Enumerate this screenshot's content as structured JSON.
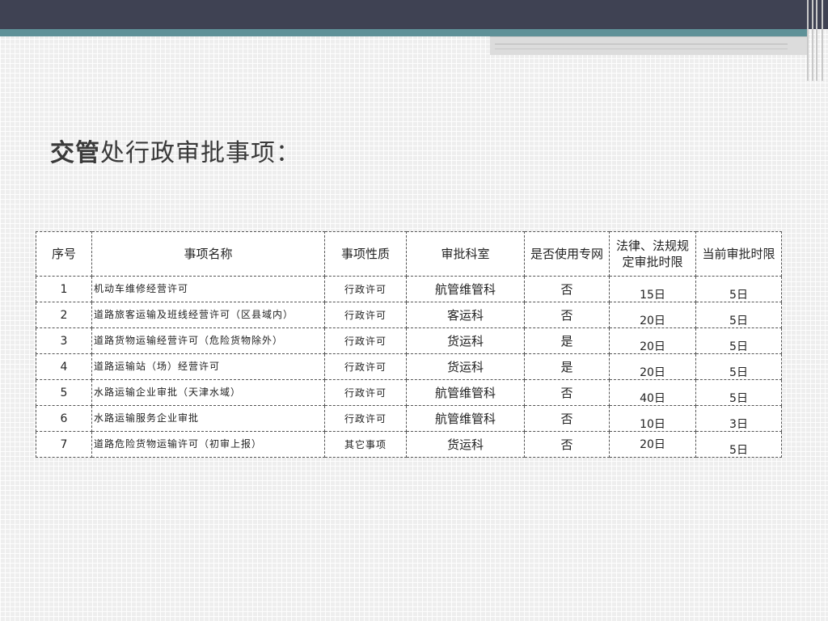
{
  "title": {
    "bold_part": "交管",
    "rest": "处行政审批事项："
  },
  "table": {
    "headers": {
      "index": "序号",
      "name": "事项名称",
      "nature": "事项性质",
      "dept": "审批科室",
      "network": "是否使用专网",
      "legal_limit": "法律、法规规定审批时限",
      "current_limit": "当前审批时限"
    },
    "rows": [
      {
        "index": "1",
        "name": "机动车维修经营许可",
        "nature": "行政许可",
        "dept": "航管维管科",
        "network": "否",
        "legal_limit": "15日",
        "current_limit": "5日"
      },
      {
        "index": "2",
        "name": "道路旅客运输及班线经营许可（区县域内）",
        "nature": "行政许可",
        "dept": "客运科",
        "network": "否",
        "legal_limit": "20日",
        "current_limit": "5日"
      },
      {
        "index": "3",
        "name": "道路货物运输经营许可（危险货物除外）",
        "nature": "行政许可",
        "dept": "货运科",
        "network": "是",
        "legal_limit": "20日",
        "current_limit": "5日"
      },
      {
        "index": "4",
        "name": "道路运输站（场）经营许可",
        "nature": "行政许可",
        "dept": "货运科",
        "network": "是",
        "legal_limit": "20日",
        "current_limit": "5日"
      },
      {
        "index": "5",
        "name": "水路运输企业审批（天津水域）",
        "nature": "行政许可",
        "dept": "航管维管科",
        "network": "否",
        "legal_limit": "40日",
        "current_limit": "5日"
      },
      {
        "index": "6",
        "name": "水路运输服务企业审批",
        "nature": "行政许可",
        "dept": "航管维管科",
        "network": "否",
        "legal_limit": "10日",
        "current_limit": "3日"
      },
      {
        "index": "7",
        "name": "道路危险货物运输许可（初审上报）",
        "nature": "其它事项",
        "dept": "货运科",
        "network": "否",
        "legal_limit": "20日",
        "current_limit": "5日"
      }
    ]
  }
}
